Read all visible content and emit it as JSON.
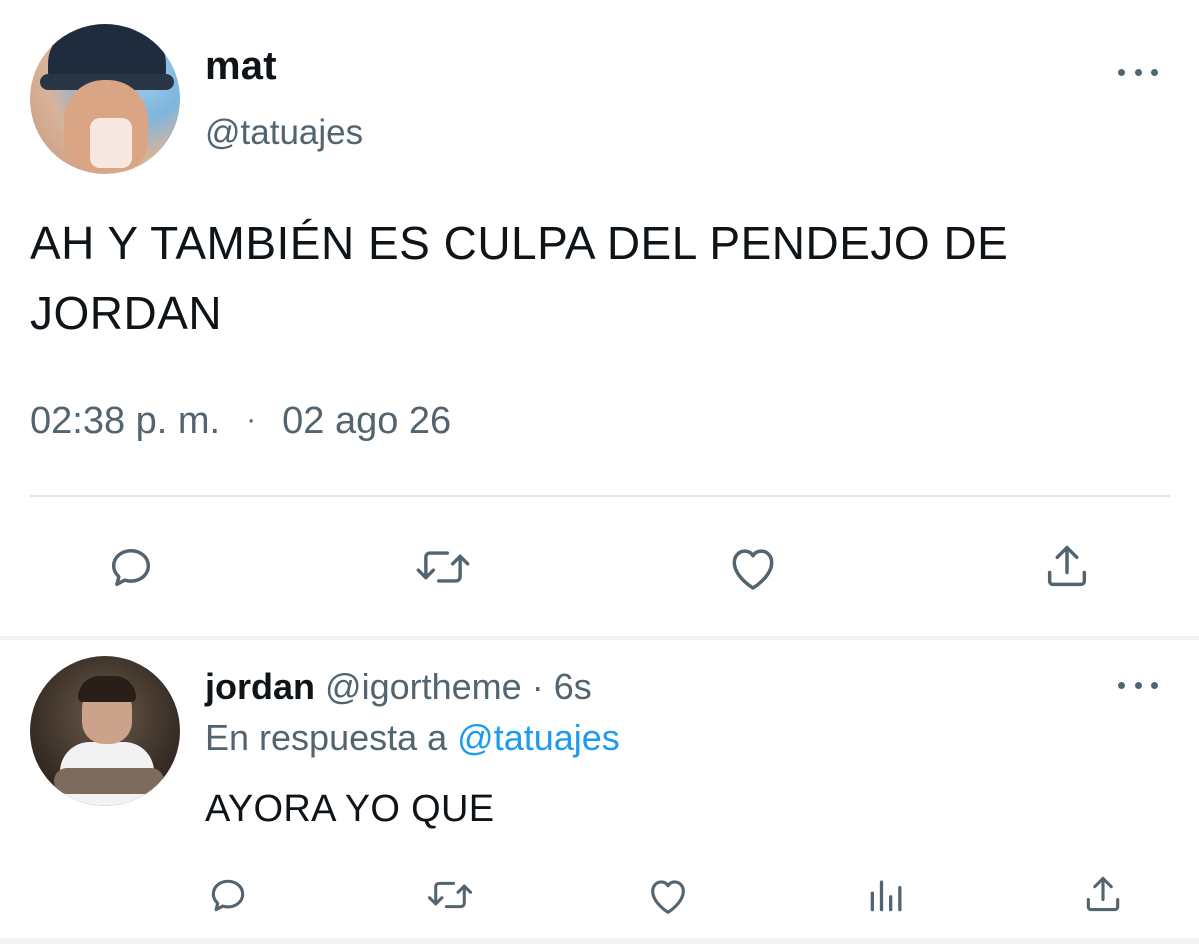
{
  "tweet": {
    "author": {
      "display_name": "mat",
      "handle": "@tatuajes",
      "avatar": "profile-photo"
    },
    "text": "AH Y TAMBIÉN ES CULPA DEL PENDEJO DE JORDAN",
    "time": "02:38 p. m.",
    "separator": "·",
    "date": "02 ago 26",
    "more_icon": "more-horizontal-icon",
    "actions": [
      "reply-icon",
      "retweet-icon",
      "like-icon",
      "share-icon"
    ]
  },
  "reply": {
    "author": {
      "display_name": "jordan",
      "handle": "@igortheme",
      "separator": "·",
      "age": "6s",
      "avatar": "profile-photo"
    },
    "context_prefix": "En respuesta a",
    "context_mention": "@tatuajes",
    "text": "AYORA YO QUE",
    "more_icon": "more-horizontal-icon",
    "actions": [
      "reply-icon",
      "retweet-icon",
      "like-icon",
      "analytics-icon",
      "share-icon"
    ]
  },
  "colors": {
    "text_primary": "#0f1419",
    "text_secondary": "#536471",
    "link": "#1d9bf0",
    "divider": "#e1e8ed",
    "background": "#ffffff"
  }
}
